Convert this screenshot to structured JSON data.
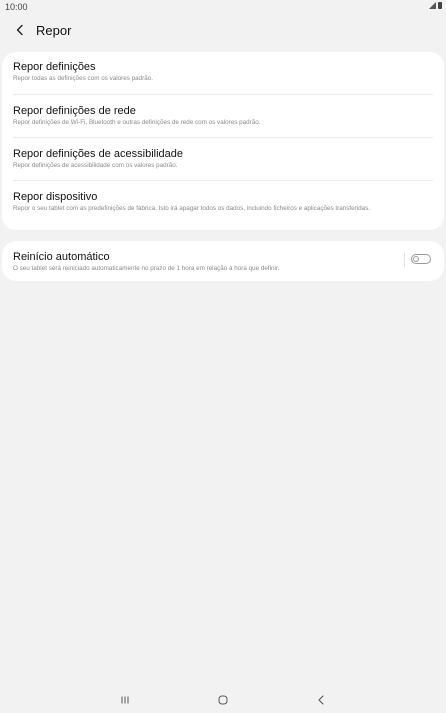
{
  "status_bar": {
    "time": "10:00"
  },
  "header": {
    "title": "Repor",
    "back_icon": "chevron-left-icon"
  },
  "reset_items": [
    {
      "title": "Repor definições",
      "description": "Repor todas as definições com os valores padrão."
    },
    {
      "title": "Repor definições de rede",
      "description": "Repor definições de Wi-Fi, Bluetooth e outras definições de rede com os valores padrão."
    },
    {
      "title": "Repor definições de acessibilidade",
      "description": "Repor definições de acessibilidade com os valores padrão."
    },
    {
      "title": "Repor dispositivo",
      "description": "Repor o seu tablet com as predefinições de fábrica. Isto irá apagar todos os dados, incluindo ficheiros e aplicações transferidas."
    }
  ],
  "auto_restart": {
    "title": "Reinício automático",
    "description": "O seu tablet será reiniciado automaticamente no prazo de 1 hora em relação à hora que definir.",
    "enabled": false
  },
  "nav_bar": {
    "recents_icon": "recents-icon",
    "home_icon": "home-icon",
    "back_icon": "back-icon"
  }
}
